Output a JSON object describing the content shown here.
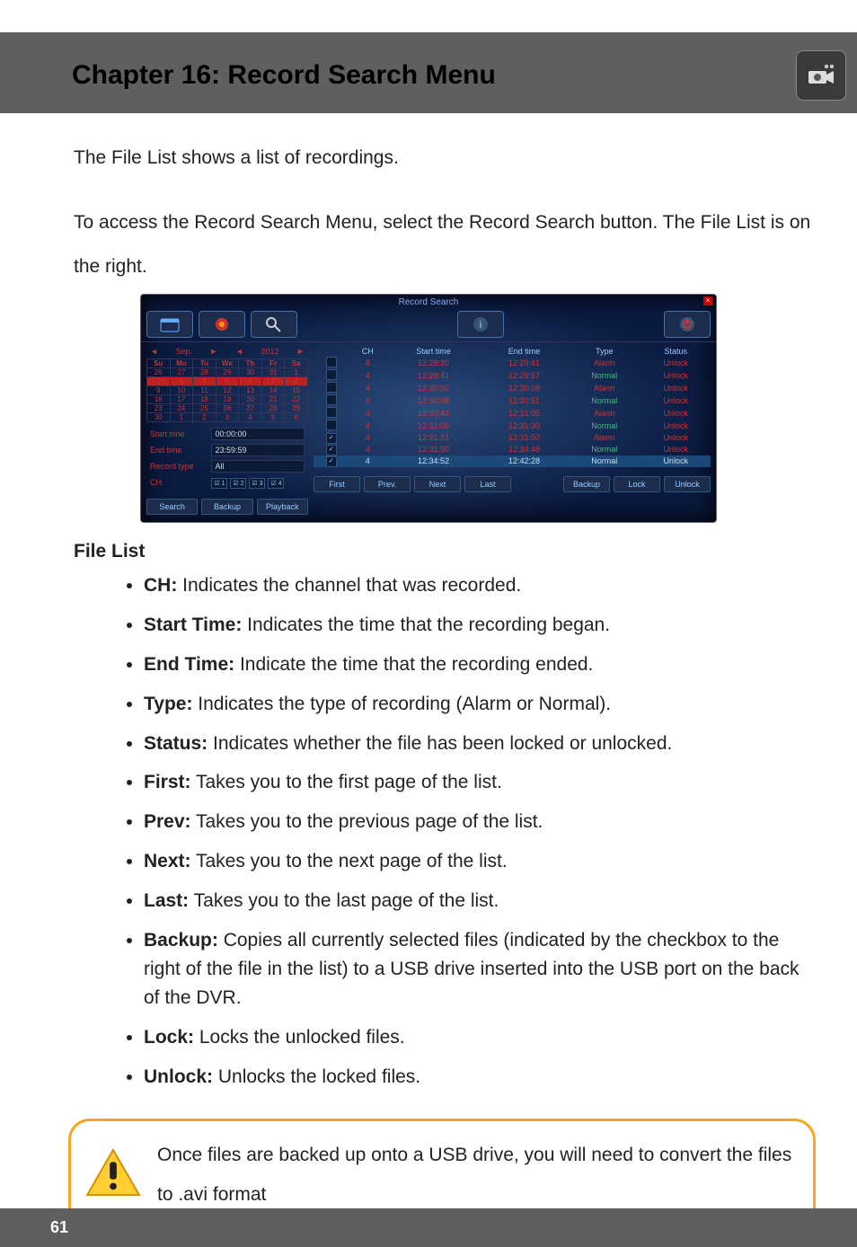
{
  "header": {
    "title": "Chapter 16: Record Search Menu"
  },
  "intro": {
    "p1": "The File List shows a list of recordings.",
    "p2": "To access the Record Search Menu, select the Record Search button. The File List is on the right."
  },
  "dvr": {
    "title": "Record Search",
    "month_nav": {
      "prev": "◄",
      "month": "Sep.",
      "next": "►",
      "yprev": "◄",
      "year": "2012",
      "ynext": "►"
    },
    "calendar": {
      "days": [
        "Su",
        "Mo",
        "Tu",
        "We",
        "Th",
        "Fr",
        "Sa"
      ],
      "grid": [
        [
          "26",
          "27",
          "28",
          "29",
          "30",
          "31",
          "1"
        ],
        [
          "2",
          "3",
          "4",
          "5",
          "6",
          "7",
          "8"
        ],
        [
          "9",
          "10",
          "11",
          "12",
          "13",
          "14",
          "15"
        ],
        [
          "16",
          "17",
          "18",
          "19",
          "20",
          "21",
          "22"
        ],
        [
          "23",
          "24",
          "25",
          "26",
          "27",
          "28",
          "29"
        ],
        [
          "30",
          "1",
          "2",
          "3",
          "4",
          "5",
          "6"
        ]
      ]
    },
    "fields": {
      "start_label": "Start time",
      "start_val": "00:00:00",
      "end_label": "End time",
      "end_val": "23:59:59",
      "type_label": "Record type",
      "type_val": "All",
      "ch_label": "CH",
      "ch_boxes": [
        "☑ 1",
        "☑ 2",
        "☑ 3",
        "☑ 4"
      ]
    },
    "left_buttons": {
      "search": "Search",
      "backup": "Backup",
      "playback": "Playback"
    },
    "grid": {
      "cols": [
        "",
        "CH",
        "Start time",
        "End time",
        "Type",
        "Status"
      ],
      "rows": [
        {
          "chk": "",
          "ch": "4",
          "start": "12:29:20",
          "end": "12:29:41",
          "type": "Alarm",
          "status": "Unlock",
          "sel": false
        },
        {
          "chk": "",
          "ch": "4",
          "start": "12:29:41",
          "end": "12:29:57",
          "type": "Normal",
          "status": "Unlock",
          "sel": false
        },
        {
          "chk": "",
          "ch": "4",
          "start": "12:30:50",
          "end": "12:30:08",
          "type": "Alarm",
          "status": "Unlock",
          "sel": false
        },
        {
          "chk": "",
          "ch": "4",
          "start": "12:30:08",
          "end": "12:30:51",
          "type": "Normal",
          "status": "Unlock",
          "sel": false
        },
        {
          "chk": "",
          "ch": "4",
          "start": "12:30:44",
          "end": "12:31:05",
          "type": "Alarm",
          "status": "Unlock",
          "sel": false
        },
        {
          "chk": "",
          "ch": "4",
          "start": "12:31:05",
          "end": "12:31:30",
          "type": "Normal",
          "status": "Unlock",
          "sel": false
        },
        {
          "chk": "✓",
          "ch": "4",
          "start": "12:31:31",
          "end": "12:31:50",
          "type": "Alarm",
          "status": "Unlock",
          "sel": false
        },
        {
          "chk": "✓",
          "ch": "4",
          "start": "12:31:50",
          "end": "12:34:48",
          "type": "Normal",
          "status": "Unlock",
          "sel": false
        },
        {
          "chk": "✓",
          "ch": "4",
          "start": "12:34:52",
          "end": "12:42:28",
          "type": "Normal",
          "status": "Unlock",
          "sel": true
        }
      ]
    },
    "pager": {
      "first": "First",
      "prev": "Prev.",
      "next": "Next",
      "last": "Last",
      "backup": "Backup",
      "lock": "Lock",
      "unlock": "Unlock"
    }
  },
  "section_title": "File List",
  "bullets": [
    {
      "term": "CH:",
      "desc": " Indicates the channel that was recorded."
    },
    {
      "term": "Start Time:",
      "desc": " Indicates the time that the recording began."
    },
    {
      "term": "End Time:",
      "desc": " Indicate the time that the recording ended."
    },
    {
      "term": "Type:",
      "desc": " Indicates the type of recording (Alarm or Normal)."
    },
    {
      "term": "Status:",
      "desc": " Indicates whether the file has been locked or unlocked."
    },
    {
      "term": "First:",
      "desc": " Takes you to the first page of the list."
    },
    {
      "term": "Prev:",
      "desc": " Takes you to the previous page of the list."
    },
    {
      "term": "Next:",
      "desc": " Takes you to the next page of the list."
    },
    {
      "term": "Last:",
      "desc": " Takes you to the last page of the list."
    },
    {
      "term": "Backup:",
      "desc": " Copies all currently selected files (indicated by the checkbox to the right of the file in the list) to a USB drive inserted into the USB port on the back of the DVR."
    },
    {
      "term": "Lock:",
      "desc": " Locks the unlocked files."
    },
    {
      "term": "Unlock:",
      "desc": " Unlocks the locked files."
    }
  ],
  "note": {
    "text": "Once files are backed up onto a USB drive, you will need to convert the files to .avi format"
  },
  "footer": {
    "page": "61"
  }
}
